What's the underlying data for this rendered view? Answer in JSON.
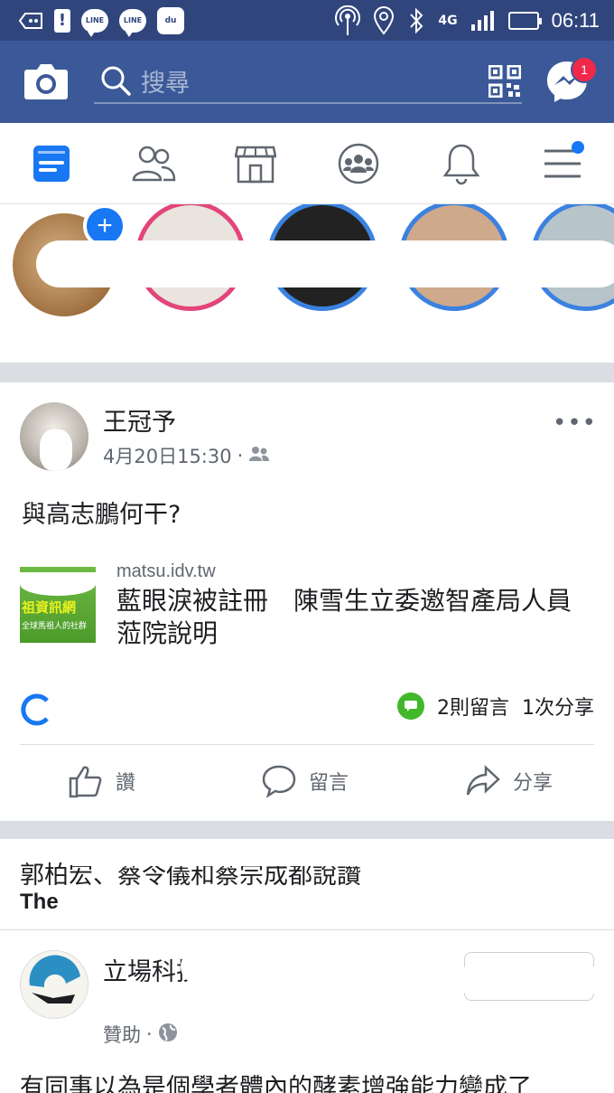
{
  "status_bar": {
    "left_badges": [
      "LINE",
      "LINE",
      "du"
    ],
    "network": "4G",
    "time": "06:11"
  },
  "header": {
    "search_placeholder": "搜尋",
    "messenger_badge": "1"
  },
  "tabs": [
    "news-feed",
    "friends",
    "marketplace",
    "groups",
    "notifications",
    "menu"
  ],
  "post": {
    "author": "王冠予",
    "timestamp": "4月20日15:30",
    "separator": "·",
    "text": "與高志鵬何干?",
    "link": {
      "domain": "matsu.idv.tw",
      "title": "藍眼淚被註冊　陳雪生立委邀智產局人員蒞院說明",
      "thumb_text": "祖資訊網",
      "thumb_subtext": "全球馬祖人的社群"
    },
    "comments_count": "2則留言",
    "shares_count": "1次分享",
    "actions": {
      "like": "讚",
      "comment": "留言",
      "share": "分享"
    }
  },
  "next_post": {
    "line1": "郭柏宏、蔡令儀和蔡宗成都說讚",
    "line2": "The"
  },
  "sponsored_post": {
    "name": "立場科技",
    "label": "贊助",
    "separator": "·",
    "text": "有同事以為是個學者體內的酵素增強能力變成了"
  },
  "colors": {
    "header": "#3b5998",
    "statusbar": "#31457d",
    "accent": "#1877f2",
    "badge": "#f02849",
    "comment_green": "#42b72a"
  }
}
